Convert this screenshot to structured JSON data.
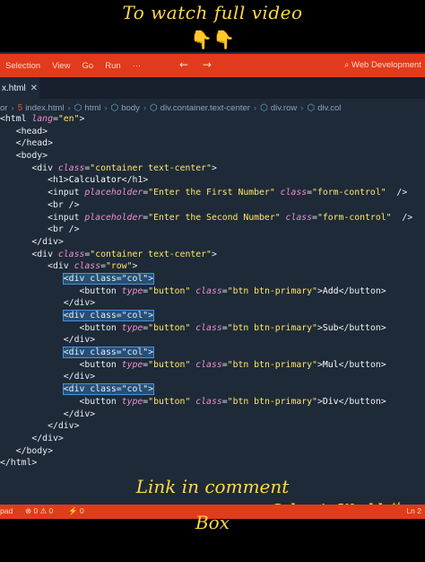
{
  "overlay": {
    "top_caption": "To watch full video",
    "hands": "👇👇",
    "watermark": "Selvan's World",
    "watermark_sparkle": "✨",
    "bottom_caption_1": "Link in comment",
    "bottom_caption_2": "Box"
  },
  "menubar": {
    "items": [
      "Selection",
      "View",
      "Go",
      "Run",
      "···"
    ],
    "back": "←",
    "forward": "→",
    "search_icon": "search-icon",
    "search_text": "⌕ Web Development"
  },
  "tab": {
    "label": "x.html",
    "close": "✕"
  },
  "breadcrumbs": [
    "or",
    "index.html",
    "html",
    "body",
    "div.container.text-center",
    "div.row",
    "div.col"
  ],
  "code_lines": [
    [
      [
        "tg",
        "<html "
      ],
      [
        "at",
        "lang"
      ],
      [
        "tg",
        "="
      ],
      [
        "st",
        "\"en\""
      ],
      [
        "tg",
        ">"
      ]
    ],
    [
      [
        "tg",
        "   <head>"
      ]
    ],
    [
      [
        "tg",
        "   </head>"
      ]
    ],
    [
      [
        "tg",
        "   <body>"
      ]
    ],
    [
      [
        "tg",
        "      <div "
      ],
      [
        "at",
        "class"
      ],
      [
        "tg",
        "="
      ],
      [
        "st",
        "\"container text-center\""
      ],
      [
        "tg",
        ">"
      ]
    ],
    [
      [
        "tg",
        "         <h1>"
      ],
      [
        "tx",
        "Calculator"
      ],
      [
        "tg",
        "</h1>"
      ]
    ],
    [
      [
        "tg",
        "         <input "
      ],
      [
        "at",
        "placeholder"
      ],
      [
        "tg",
        "="
      ],
      [
        "st",
        "\"Enter the First Number\""
      ],
      [
        "tg",
        " "
      ],
      [
        "at",
        "class"
      ],
      [
        "tg",
        "="
      ],
      [
        "st",
        "\"form-control\""
      ],
      [
        "tg",
        "  />"
      ]
    ],
    [
      [
        "tg",
        "         <br />"
      ]
    ],
    [
      [
        "tg",
        "         <input "
      ],
      [
        "at",
        "placeholder"
      ],
      [
        "tg",
        "="
      ],
      [
        "st",
        "\"Enter the Second Number\""
      ],
      [
        "tg",
        " "
      ],
      [
        "at",
        "class"
      ],
      [
        "tg",
        "="
      ],
      [
        "st",
        "\"form-control\""
      ],
      [
        "tg",
        "  />"
      ]
    ],
    [
      [
        "tg",
        "         <br />"
      ]
    ],
    [
      [
        "tg",
        "      </div>"
      ]
    ],
    [
      [
        "tg",
        "      <div "
      ],
      [
        "at",
        "class"
      ],
      [
        "tg",
        "="
      ],
      [
        "st",
        "\"container text-center\""
      ],
      [
        "tg",
        ">"
      ]
    ],
    [
      [
        "tg",
        "         <div "
      ],
      [
        "at",
        "class"
      ],
      [
        "tg",
        "="
      ],
      [
        "st",
        "\"row\""
      ],
      [
        "tg",
        ">"
      ]
    ],
    [
      [
        "tg",
        "            "
      ],
      [
        "hl",
        "<div class=\"col\">"
      ]
    ],
    [
      [
        "tg",
        "               <button "
      ],
      [
        "at",
        "type"
      ],
      [
        "tg",
        "="
      ],
      [
        "st",
        "\"button\""
      ],
      [
        "tg",
        " "
      ],
      [
        "at",
        "class"
      ],
      [
        "tg",
        "="
      ],
      [
        "st",
        "\"btn btn-primary\""
      ],
      [
        "tg",
        ">"
      ],
      [
        "tx",
        "Add"
      ],
      [
        "tg",
        "</button>"
      ]
    ],
    [
      [
        "tg",
        "            </div>"
      ]
    ],
    [
      [
        "tg",
        "            "
      ],
      [
        "hl",
        "<div class=\"col\">"
      ]
    ],
    [
      [
        "tg",
        "               <button "
      ],
      [
        "at",
        "type"
      ],
      [
        "tg",
        "="
      ],
      [
        "st",
        "\"button\""
      ],
      [
        "tg",
        " "
      ],
      [
        "at",
        "class"
      ],
      [
        "tg",
        "="
      ],
      [
        "st",
        "\"btn btn-primary\""
      ],
      [
        "tg",
        ">"
      ],
      [
        "tx",
        "Sub"
      ],
      [
        "tg",
        "</button>"
      ]
    ],
    [
      [
        "tg",
        "            </div>"
      ]
    ],
    [
      [
        "tg",
        "            "
      ],
      [
        "hl",
        "<div class=\"col\">"
      ]
    ],
    [
      [
        "tg",
        "               <button "
      ],
      [
        "at",
        "type"
      ],
      [
        "tg",
        "="
      ],
      [
        "st",
        "\"button\""
      ],
      [
        "tg",
        " "
      ],
      [
        "at",
        "class"
      ],
      [
        "tg",
        "="
      ],
      [
        "st",
        "\"btn btn-primary\""
      ],
      [
        "tg",
        ">"
      ],
      [
        "tx",
        "Mul"
      ],
      [
        "tg",
        "</button>"
      ]
    ],
    [
      [
        "tg",
        "            </div>"
      ]
    ],
    [
      [
        "tg",
        "            "
      ],
      [
        "hl",
        "<div class=\"col\">"
      ]
    ],
    [
      [
        "tg",
        "               <button "
      ],
      [
        "at",
        "type"
      ],
      [
        "tg",
        "="
      ],
      [
        "st",
        "\"button\""
      ],
      [
        "tg",
        " "
      ],
      [
        "at",
        "class"
      ],
      [
        "tg",
        "="
      ],
      [
        "st",
        "\"btn btn-primary\""
      ],
      [
        "tg",
        ">"
      ],
      [
        "tx",
        "Div"
      ],
      [
        "tg",
        "</button>"
      ]
    ],
    [
      [
        "tg",
        "            </div>"
      ]
    ],
    [
      [
        "tg",
        "         </div>"
      ]
    ],
    [
      [
        "tg",
        "      </div>"
      ]
    ],
    [
      [
        "tg",
        "   </body>"
      ]
    ],
    [
      [
        "tg",
        "</html>"
      ]
    ]
  ],
  "statusbar": {
    "left": "pad",
    "problems": "⊗ 0 ⚠ 0",
    "ports": "⚡ 0",
    "right": "Ln 2"
  }
}
